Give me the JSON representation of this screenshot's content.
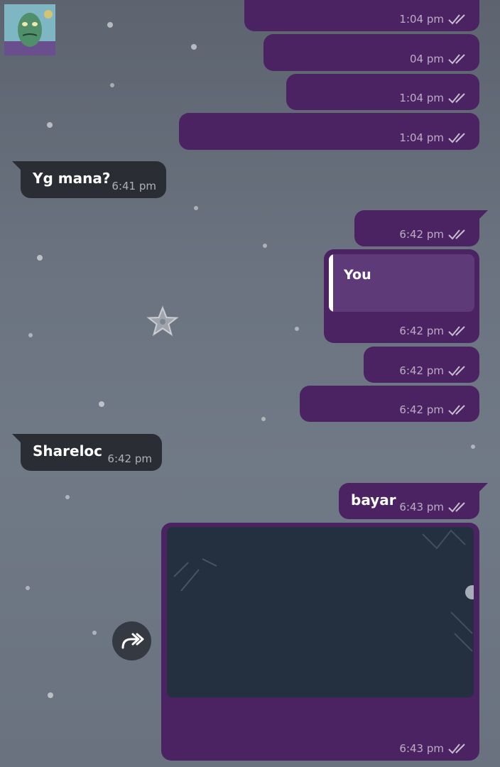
{
  "messages": [
    {
      "id": "m1",
      "direction": "outgoing",
      "text": "",
      "time": "1:04 pm",
      "status": "read"
    },
    {
      "id": "m2",
      "direction": "outgoing",
      "text": "",
      "time": "04 pm",
      "status": "read"
    },
    {
      "id": "m3",
      "direction": "outgoing",
      "text": "",
      "time": "1:04 pm",
      "status": "read"
    },
    {
      "id": "m4",
      "direction": "outgoing",
      "text": "",
      "time": "1:04 pm",
      "status": "read"
    },
    {
      "id": "m5",
      "direction": "incoming",
      "text": "Yg mana?",
      "time": "6:41 pm"
    },
    {
      "id": "m6",
      "direction": "outgoing",
      "text": "",
      "time": "6:42 pm",
      "status": "read"
    },
    {
      "id": "m7",
      "direction": "outgoing",
      "reply_to": "You",
      "text": "",
      "time": "6:42 pm",
      "status": "read"
    },
    {
      "id": "m8",
      "direction": "outgoing",
      "text": "",
      "time": "6:42 pm",
      "status": "read"
    },
    {
      "id": "m9",
      "direction": "outgoing",
      "text": "",
      "time": "6:42 pm",
      "status": "read"
    },
    {
      "id": "m10",
      "direction": "incoming",
      "text": "Shareloc",
      "time": "6:42 pm"
    },
    {
      "id": "m11",
      "direction": "outgoing",
      "text": "bayar",
      "time": "6:43 pm",
      "status": "read"
    },
    {
      "id": "m12",
      "direction": "outgoing",
      "media": "image",
      "text": "",
      "time": "6:43 pm",
      "status": "read"
    }
  ],
  "icons": {
    "read_receipt": "double-check-icon",
    "forward": "forward-icon",
    "avatar": "sticker-avatar"
  },
  "colors": {
    "outgoing_bubble": "#4b2363",
    "incoming_bubble": "#2a2d33",
    "reply_quote": "#5f3a78"
  }
}
